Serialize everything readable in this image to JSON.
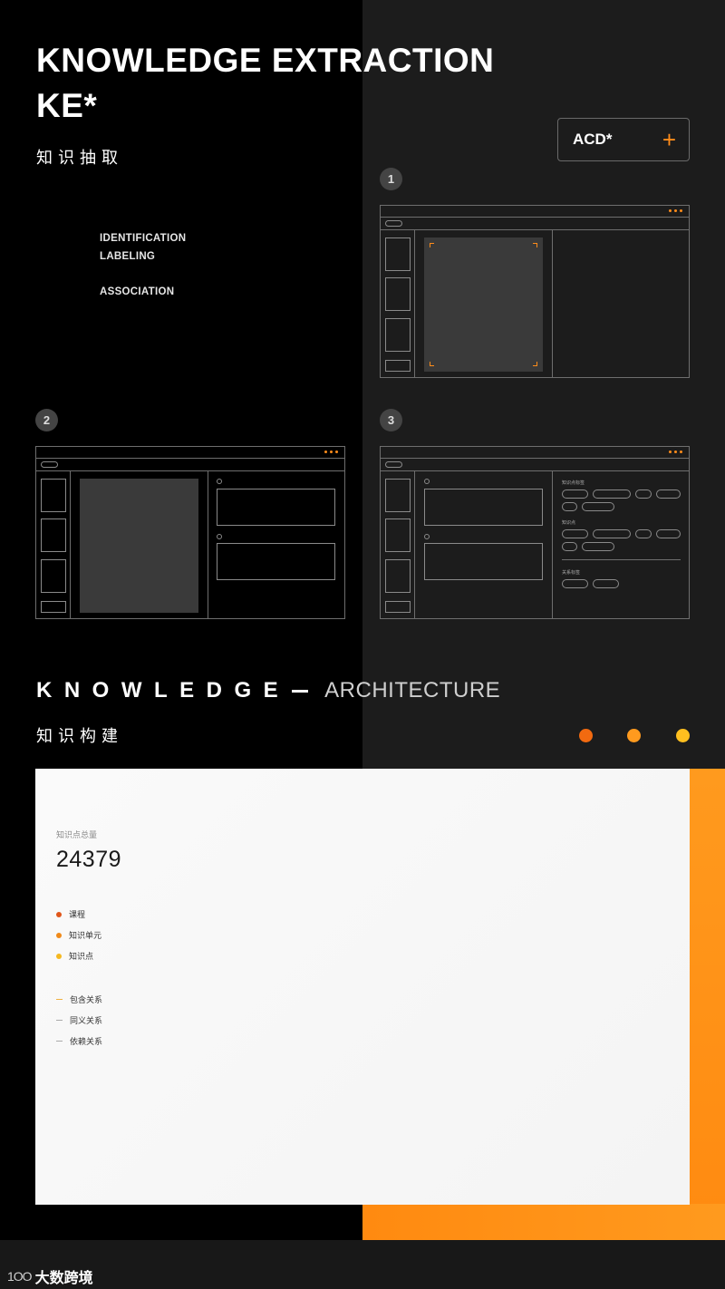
{
  "hero": {
    "title_line1": "KNOWLEDGE EXTRACTION",
    "title_line2": "KE*",
    "subtitle": "知识抽取"
  },
  "features": [
    "IDENTIFICATION",
    "LABELING",
    "ASSOCIATION"
  ],
  "acd_button": {
    "label": "ACD*",
    "icon": "plus-icon"
  },
  "steps": [
    "1",
    "2",
    "3"
  ],
  "step3_window": {
    "group1_label": "知识点标签",
    "group2_label": "知识点",
    "group3_label": "关系标签"
  },
  "architecture": {
    "title_bold": "KNOWLEDGE",
    "title_light": "ARCHITECTURE",
    "subtitle": "知识构建",
    "dot_colors": [
      "#f26a10",
      "#ff9a1e",
      "#ffbf1f"
    ]
  },
  "stats_panel": {
    "label": "知识点总量",
    "value": "24379",
    "node_legend": [
      {
        "label": "课程",
        "color": "#e0561a"
      },
      {
        "label": "知识单元",
        "color": "#f08a1a"
      },
      {
        "label": "知识点",
        "color": "#f5b820"
      }
    ],
    "relation_legend": [
      {
        "label": "包含关系",
        "color": "#f0b040"
      },
      {
        "label": "同义关系",
        "color": "#aaaaaa"
      },
      {
        "label": "依赖关系",
        "color": "#aaaaaa"
      }
    ]
  },
  "brand": {
    "logo": "1OO",
    "name": "大数跨境"
  },
  "colors": {
    "accent": "#ff8c1a",
    "panel_bg": "#f6f6f6",
    "dark_bg": "#1c1c1c"
  }
}
